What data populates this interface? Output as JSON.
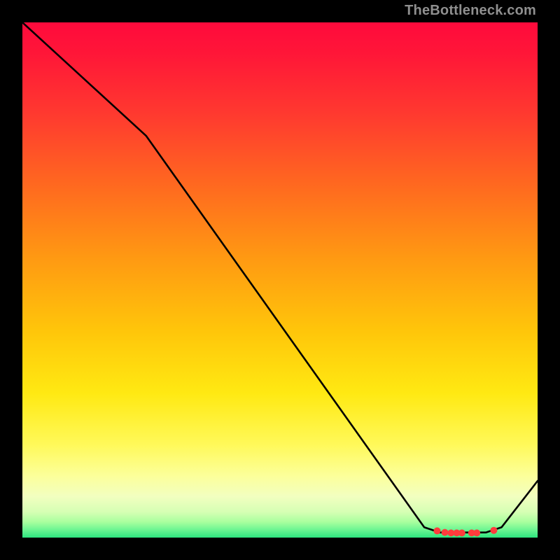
{
  "attribution": "TheBottleneck.com",
  "chart_data": {
    "type": "line",
    "title": "",
    "xlabel": "",
    "ylabel": "",
    "xlim": [
      0,
      100
    ],
    "ylim": [
      0,
      100
    ],
    "background_gradient": {
      "top_color": "#ff0a3c",
      "mid_color": "#ffe912",
      "bottom_color": "#2de57f"
    },
    "series": [
      {
        "name": "curve",
        "points": [
          {
            "x": 0,
            "y": 100
          },
          {
            "x": 24,
            "y": 78
          },
          {
            "x": 78,
            "y": 2
          },
          {
            "x": 81,
            "y": 1
          },
          {
            "x": 90,
            "y": 1
          },
          {
            "x": 93,
            "y": 2
          },
          {
            "x": 100,
            "y": 11
          }
        ]
      }
    ],
    "markers": [
      {
        "x": 80.5,
        "y": 1.3
      },
      {
        "x": 82.0,
        "y": 1.0
      },
      {
        "x": 83.2,
        "y": 0.9
      },
      {
        "x": 84.3,
        "y": 0.9
      },
      {
        "x": 85.3,
        "y": 0.9
      },
      {
        "x": 87.2,
        "y": 0.9
      },
      {
        "x": 88.2,
        "y": 0.9
      },
      {
        "x": 91.5,
        "y": 1.4
      }
    ],
    "marker_color": "#ff3c3c",
    "curve_stroke": "#000000",
    "curve_stroke_width": 2.6
  }
}
